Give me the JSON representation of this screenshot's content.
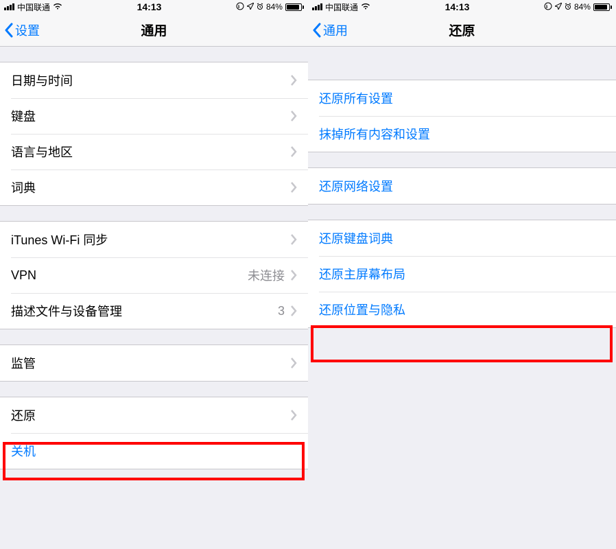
{
  "status": {
    "carrier": "中国联通",
    "time": "14:13",
    "battery": "84%"
  },
  "left": {
    "back": "设置",
    "title": "通用",
    "g1": {
      "date": "日期与时间",
      "keyboard": "键盘",
      "lang": "语言与地区",
      "dict": "词典"
    },
    "g2": {
      "itunes": "iTunes Wi-Fi 同步",
      "vpn": "VPN",
      "vpn_val": "未连接",
      "profiles": "描述文件与设备管理",
      "profiles_val": "3"
    },
    "g3": {
      "reg": "监管"
    },
    "g4": {
      "reset": "还原",
      "shutdown": "关机"
    }
  },
  "right": {
    "back": "通用",
    "title": "还原",
    "g1": {
      "all": "还原所有设置",
      "erase": "抹掉所有内容和设置"
    },
    "g2": {
      "net": "还原网络设置"
    },
    "g3": {
      "kb": "还原键盘词典",
      "home": "还原主屏幕布局",
      "loc": "还原位置与隐私"
    }
  }
}
